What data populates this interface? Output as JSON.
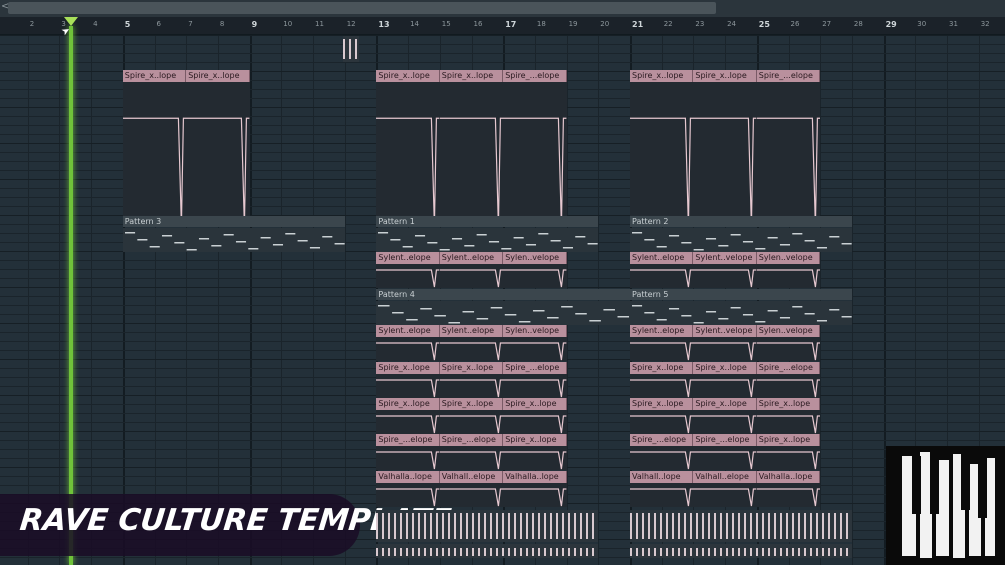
{
  "window": {
    "close_label": "<"
  },
  "ruler": {
    "bars": [
      "2",
      "3",
      "4",
      "5",
      "6",
      "7",
      "8",
      "9",
      "10",
      "11",
      "12",
      "13",
      "14",
      "15",
      "16",
      "17",
      "18",
      "19",
      "20",
      "21",
      "22",
      "23",
      "24",
      "25",
      "26",
      "27",
      "28",
      "29",
      "30",
      "31",
      "32"
    ]
  },
  "clips": {
    "row1": [
      "Spire_x..lope",
      "Spire_x..lope",
      "Spire_x..lope",
      "Spire_x..lope",
      "Spire_...elope",
      "Spire_x..lope",
      "Spire_x..lope",
      "Spire_...elope"
    ],
    "patterns_a": [
      "Pattern 3",
      "Pattern 1",
      "Pattern 2"
    ],
    "row_syl1": [
      "Sylent..elope",
      "Sylent..elope",
      "Sylen..velope",
      "Sylent..elope",
      "Sylent..velope",
      "Sylen..velope"
    ],
    "patterns_b": [
      "Pattern 4",
      "Pattern 5"
    ],
    "row_syl2": [
      "Sylent..elope",
      "Sylent..elope",
      "Sylen..velope",
      "Sylent..elope",
      "Sylent..velope",
      "Sylen..velope"
    ],
    "row_spire2": [
      "Spire_x..lope",
      "Spire_x..lope",
      "Spire_...elope",
      "Spire_x..lope",
      "Spire_x..lope",
      "Spire_...elope"
    ],
    "row_spire3": [
      "Spire_x..lope",
      "Spire_x..lope",
      "Spire_x..lope",
      "Spire_x..lope",
      "Spire_x..lope",
      "Spire_x..lope"
    ],
    "row_spire4": [
      "Spire_...elope",
      "Spire_...elope",
      "Spire_x..lope",
      "Spire_...elope",
      "Spire_...elope",
      "Spire_x..lope"
    ],
    "row_valhalla": [
      "Valhalla..lope",
      "Valhall..elope",
      "Valhalla..lope",
      "Valhall..lope",
      "Valhall..elope",
      "Valhalla..lope"
    ]
  },
  "overlay": {
    "title": "RAVE CULTURE TEMPLATE"
  },
  "colors": {
    "automation_clip": "#b9909d",
    "pattern_clip": "#3b464d",
    "playhead": "#6fc23a",
    "background": "#233039"
  }
}
